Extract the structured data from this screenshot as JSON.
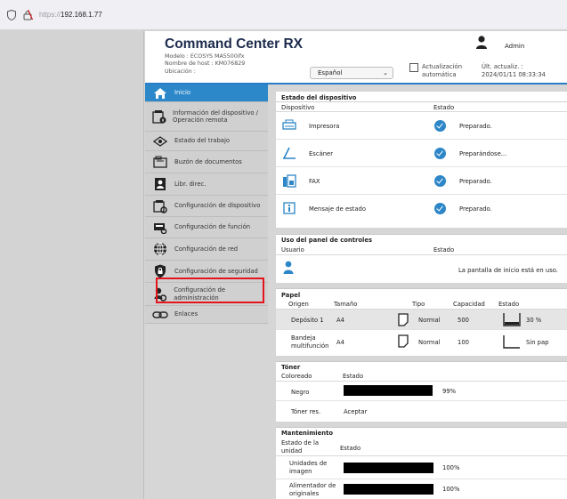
{
  "browser": {
    "url_scheme": "https://",
    "url_host": "192.168.1.77"
  },
  "header": {
    "title": "Command Center RX",
    "model": "Modelo : ECOSYS MA5500ifx",
    "host": "Nombre de host : KM076829",
    "location": "Ubicación :",
    "language": "Español",
    "auto_update_1": "Actualización",
    "auto_update_2": "automática",
    "last_update_label": "Últ. actualiz. :",
    "last_update_value": "2024/01/11 08:33:34",
    "user": "Admin"
  },
  "sidebar": {
    "items": [
      {
        "label": "Inicio"
      },
      {
        "label": "Información del dispositivo / Operación remota"
      },
      {
        "label": "Estado del trabajo"
      },
      {
        "label": "Buzón de documentos"
      },
      {
        "label": "Libr. direc."
      },
      {
        "label": "Configuración de dispositivo"
      },
      {
        "label": "Configuración de función"
      },
      {
        "label": "Configuración de red"
      },
      {
        "label": "Configuración de seguridad"
      },
      {
        "label": "Configuración de administración"
      },
      {
        "label": "Enlaces"
      }
    ]
  },
  "device_status": {
    "title": "Estado del dispositivo",
    "col_device": "Dispositivo",
    "col_status": "Estado",
    "rows": [
      {
        "name": "Impresora",
        "status": "Preparado."
      },
      {
        "name": "Escáner",
        "status": "Preparándose..."
      },
      {
        "name": "FAX",
        "status": "Preparado."
      },
      {
        "name": "Mensaje de estado",
        "status": "Preparado."
      }
    ]
  },
  "panel_usage": {
    "title": "Uso del panel de controles",
    "col_user": "Usuario",
    "col_status": "Estado",
    "status": "La pantalla de inicio está en uso."
  },
  "paper": {
    "title": "Papel",
    "cols": [
      "Origen",
      "Tamaño",
      "Tipo",
      "Capacidad",
      "Estado"
    ],
    "rows": [
      {
        "source": "Depósito 1",
        "size": "A4",
        "type": "Normal",
        "capacity": "500",
        "status": "30 %"
      },
      {
        "source": "Bandeja multifunción",
        "size": "A4",
        "type": "Normal",
        "capacity": "100",
        "status": "Sin pap"
      }
    ]
  },
  "toner": {
    "title": "Tóner",
    "col_color": "Coloreado",
    "col_status": "Estado",
    "black_label": "Negro",
    "black_level": 99,
    "black_text": "99%",
    "waste_label": "Tóner res.",
    "waste_status": "Aceptar"
  },
  "maintenance": {
    "title": "Mantenimiento",
    "col_unit_1": "Estado de la",
    "col_unit_2": "unidad",
    "col_status": "Estado",
    "rows": [
      {
        "label_1": "Unidades de",
        "label_2": "imagen",
        "level": 100,
        "text": "100%"
      },
      {
        "label_1": "Alimentador de",
        "label_2": "originales",
        "level": 100,
        "text": "100%"
      }
    ]
  }
}
